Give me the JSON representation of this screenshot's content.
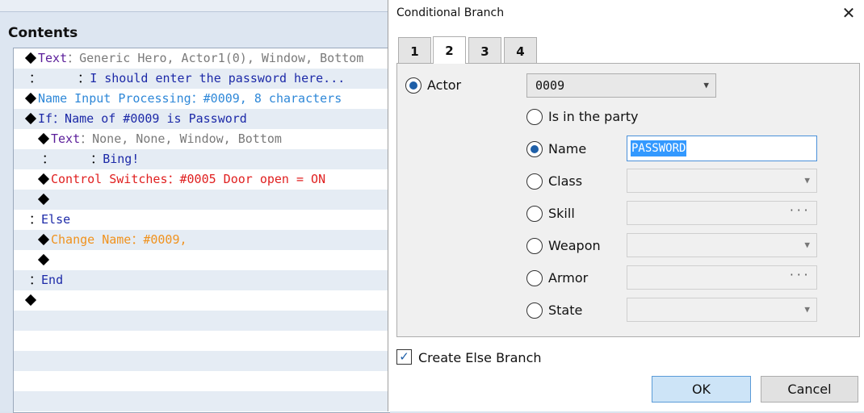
{
  "contents": {
    "label": "Contents",
    "rows": [
      {
        "indent": 0,
        "diamond": true,
        "parts": [
          {
            "t": "Text",
            "c": "c-purple"
          },
          {
            "t": "：Generic Hero, Actor1(0), Window, Bottom",
            "c": "c-grey"
          }
        ]
      },
      {
        "indent": 0,
        "diamond": false,
        "parts": [
          {
            "t": " ：     ：",
            "c": "c-black"
          },
          {
            "t": "I should enter the password here...",
            "c": "c-navy"
          }
        ]
      },
      {
        "indent": 0,
        "diamond": true,
        "parts": [
          {
            "t": "Name Input Processing：#0009, 8 characters",
            "c": "c-blue"
          }
        ]
      },
      {
        "indent": 0,
        "diamond": true,
        "parts": [
          {
            "t": "If：Name of #0009 is Password",
            "c": "c-navy"
          }
        ]
      },
      {
        "indent": 1,
        "diamond": true,
        "parts": [
          {
            "t": "Text",
            "c": "c-purple"
          },
          {
            "t": "：None, None, Window, Bottom",
            "c": "c-grey"
          }
        ]
      },
      {
        "indent": 1,
        "diamond": false,
        "parts": [
          {
            "t": " ：     ：",
            "c": "c-black"
          },
          {
            "t": "Bing!",
            "c": "c-navy"
          }
        ]
      },
      {
        "indent": 1,
        "diamond": true,
        "parts": [
          {
            "t": "Control Switches：#0005 Door open = ON",
            "c": "c-red"
          }
        ]
      },
      {
        "indent": 1,
        "diamond": true,
        "parts": []
      },
      {
        "indent": 0,
        "diamond": false,
        "parts": [
          {
            "t": " ：",
            "c": "c-black"
          },
          {
            "t": "Else",
            "c": "c-navy"
          }
        ]
      },
      {
        "indent": 1,
        "diamond": true,
        "parts": [
          {
            "t": "Change Name：#0009,",
            "c": "c-orange"
          }
        ]
      },
      {
        "indent": 1,
        "diamond": true,
        "parts": []
      },
      {
        "indent": 0,
        "diamond": false,
        "parts": [
          {
            "t": " ：",
            "c": "c-black"
          },
          {
            "t": "End",
            "c": "c-navy"
          }
        ]
      },
      {
        "indent": 0,
        "diamond": true,
        "parts": []
      },
      {
        "indent": 0,
        "diamond": false,
        "parts": []
      },
      {
        "indent": 0,
        "diamond": false,
        "parts": []
      },
      {
        "indent": 0,
        "diamond": false,
        "parts": []
      },
      {
        "indent": 0,
        "diamond": false,
        "parts": []
      },
      {
        "indent": 0,
        "diamond": false,
        "parts": []
      }
    ]
  },
  "dialog": {
    "title": "Conditional Branch",
    "close_icon": "close-icon",
    "tabs": [
      "1",
      "2",
      "3",
      "4"
    ],
    "active_tab": "2",
    "actor_label": "Actor",
    "actor_value": "0009",
    "options": {
      "party": "Is in the party",
      "name": "Name",
      "class": "Class",
      "skill": "Skill",
      "weapon": "Weapon",
      "armor": "Armor",
      "state": "State"
    },
    "selected_option": "Name",
    "name_value": "PASSWORD",
    "ellipsis": "···",
    "create_else_label": "Create Else Branch",
    "create_else_checked": true,
    "ok_label": "OK",
    "cancel_label": "Cancel"
  }
}
